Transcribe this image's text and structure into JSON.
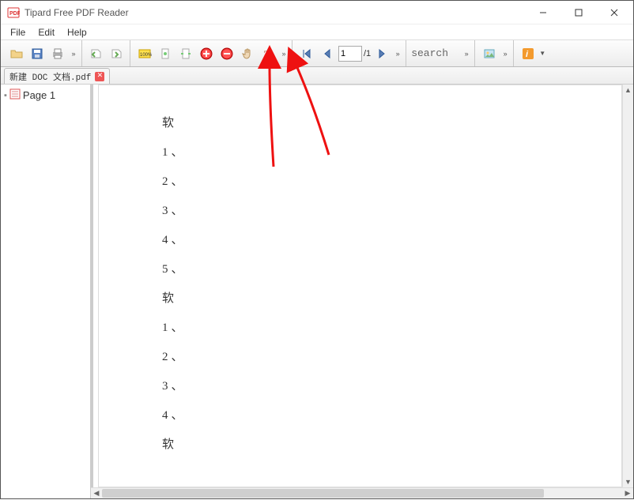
{
  "window": {
    "title": "Tipard Free PDF Reader"
  },
  "menu": {
    "file": "File",
    "edit": "Edit",
    "help": "Help"
  },
  "toolbar": {
    "nav": {
      "current_page": "1",
      "page_sep": "/1"
    },
    "search_placeholder": "search"
  },
  "tab": {
    "filename": "新建 DOC 文档.pdf"
  },
  "sidebar": {
    "page1": "Page 1"
  },
  "document": {
    "lines": [
      "软",
      "1、",
      "2、",
      "3、",
      "4、",
      "5、",
      "软",
      "1、",
      "2、",
      "3、",
      "4、",
      "软"
    ]
  }
}
